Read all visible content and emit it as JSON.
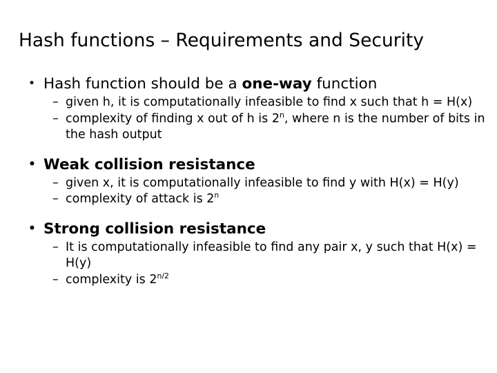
{
  "slide": {
    "title": "Hash functions – Requirements and Security",
    "bullet_marker": "•",
    "dash_marker": "–",
    "sections": [
      {
        "heading_prefix": "Hash function should be a ",
        "heading_emphasis": "one-way",
        "heading_suffix": " function",
        "heading_bold": false,
        "sub_bullets": [
          {
            "text_parts": [
              "given h, it is computationally infeasible to find x such that h = H(x)"
            ],
            "has_superscript": false
          },
          {
            "text_before": "complexity of finding x out of h is 2",
            "superscript": "n",
            "text_after": ", where n is the number of bits in the hash output",
            "has_superscript": true
          }
        ]
      },
      {
        "heading_prefix": "",
        "heading_emphasis": "Weak collision resistance",
        "heading_suffix": "",
        "heading_bold": true,
        "sub_bullets": [
          {
            "text_parts": [
              "given x, it is computationally infeasible to find y with H(x) = H(y)"
            ],
            "has_superscript": false
          },
          {
            "text_before": "complexity of attack is 2",
            "superscript": "n",
            "text_after": "",
            "has_superscript": true
          }
        ]
      },
      {
        "heading_prefix": "",
        "heading_emphasis": "Strong collision resistance",
        "heading_suffix": "",
        "heading_bold": true,
        "sub_bullets": [
          {
            "text_parts": [
              "It is computationally infeasible to find any pair x, y such that H(x) = H(y)"
            ],
            "has_superscript": false
          },
          {
            "text_before": "complexity is 2",
            "superscript": "n/2",
            "text_after": "",
            "has_superscript": true
          }
        ]
      }
    ]
  },
  "colors": {
    "background": "#ffffff",
    "text": "#000000"
  }
}
